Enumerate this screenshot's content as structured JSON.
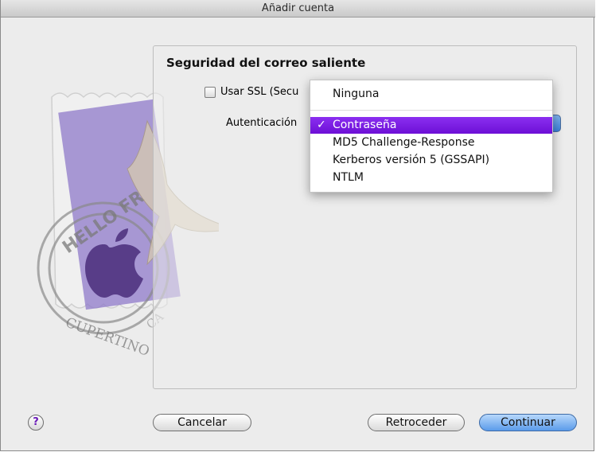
{
  "window": {
    "title": "Añadir cuenta"
  },
  "section": {
    "title": "Seguridad del correo saliente",
    "ssl_label": "Usar SSL (Secu",
    "auth_label": "Autenticación"
  },
  "auth_menu": {
    "items": [
      {
        "label": "Ninguna",
        "selected": false
      },
      {
        "label": "Contraseña",
        "selected": true
      },
      {
        "label": "MD5 Challenge-Response",
        "selected": false
      },
      {
        "label": "Kerberos versión 5 (GSSAPI)",
        "selected": false
      },
      {
        "label": "NTLM",
        "selected": false
      }
    ],
    "check_mark": "✓",
    "highlight_color": "#7a1fe0"
  },
  "artwork": {
    "stamp_text_top": "HELLO FR",
    "stamp_text_bottom": "CUPERTINO",
    "stamp_text_side": "CA"
  },
  "buttons": {
    "help": "?",
    "cancel": "Cancelar",
    "back": "Retroceder",
    "continue": "Continuar"
  }
}
